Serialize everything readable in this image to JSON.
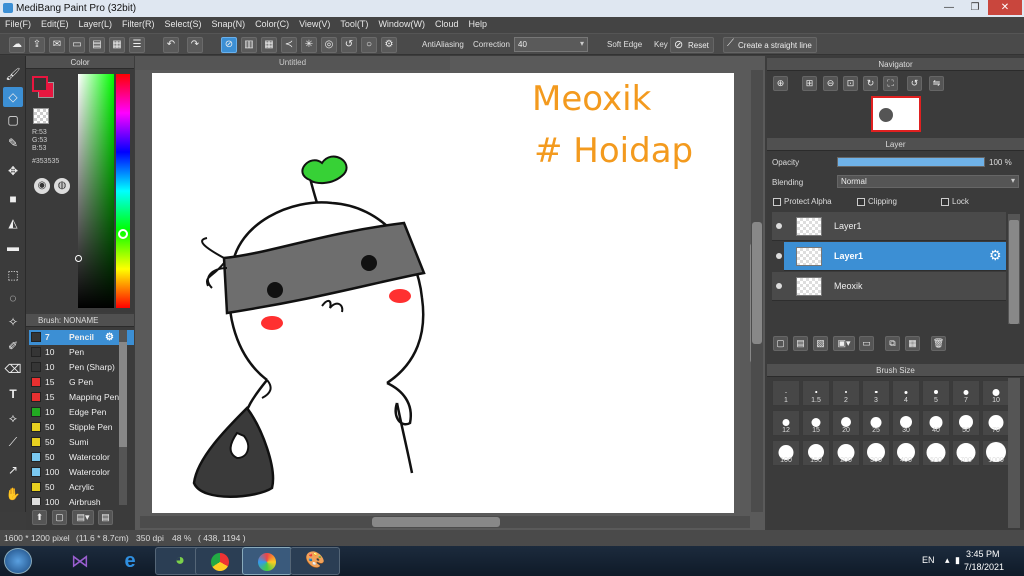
{
  "window": {
    "title": "MediBang Paint Pro (32bit)",
    "minimize": "—",
    "restore": "❐",
    "close": "✕"
  },
  "menu": [
    "File(F)",
    "Edit(E)",
    "Layer(L)",
    "Filter(R)",
    "Select(S)",
    "Snap(N)",
    "Color(C)",
    "View(V)",
    "Tool(T)",
    "Window(W)",
    "Cloud",
    "Help"
  ],
  "toolbar": {
    "antialiasing_label": "AntiAliasing",
    "correction_label": "Correction",
    "correction_value": "40",
    "soft_edge_label": "Soft Edge",
    "key_label": "Key",
    "reset_label": "Reset",
    "straight_line_label": "Create a straight line"
  },
  "color_panel": {
    "title": "Color",
    "r": "R:53",
    "g": "G:53",
    "b": "B:53",
    "hex": "#353535",
    "fg_color": "#353535",
    "bg_color": "#e8163f"
  },
  "brush_panel": {
    "title": "Brush: NONAME",
    "items": [
      {
        "size": "7",
        "name": "Pencil",
        "color": "#353535",
        "selected": true
      },
      {
        "size": "10",
        "name": "Pen",
        "color": "#353535"
      },
      {
        "size": "10",
        "name": "Pen (Sharp)",
        "color": "#353535"
      },
      {
        "size": "15",
        "name": "G Pen",
        "color": "#e83030"
      },
      {
        "size": "15",
        "name": "Mapping Pen",
        "color": "#e83030"
      },
      {
        "size": "10",
        "name": "Edge Pen",
        "color": "#22aa22"
      },
      {
        "size": "50",
        "name": "Stipple Pen",
        "color": "#e8d020"
      },
      {
        "size": "50",
        "name": "Sumi",
        "color": "#e8d020"
      },
      {
        "size": "50",
        "name": "Watercolor",
        "color": "#7ac8f0"
      },
      {
        "size": "100",
        "name": "Watercolor",
        "color": "#7ac8f0"
      },
      {
        "size": "50",
        "name": "Acrylic",
        "color": "#e8d020"
      },
      {
        "size": "100",
        "name": "Airbrush",
        "color": "#dddddd"
      }
    ]
  },
  "canvas": {
    "tab_title": "Untitled",
    "text1": "Meoxik",
    "text2": "# Hoidap",
    "text_color": "#f39a1e"
  },
  "navigator": {
    "title": "Navigator"
  },
  "layer_panel": {
    "title": "Layer",
    "opacity_label": "Opacity",
    "opacity_value": "100 %",
    "opacity_fraction": 1.0,
    "blending_label": "Blending",
    "blending_value": "Normal",
    "protect_alpha": "Protect Alpha",
    "clipping": "Clipping",
    "lock": "Lock",
    "layers": [
      {
        "name": "Layer1",
        "selected": false
      },
      {
        "name": "Layer1",
        "selected": true
      },
      {
        "name": "Meoxik",
        "selected": false
      }
    ]
  },
  "brush_size": {
    "title": "Brush Size",
    "sizes": [
      "1",
      "1.5",
      "2",
      "3",
      "4",
      "5",
      "7",
      "10",
      "12",
      "15",
      "20",
      "25",
      "30",
      "40",
      "50",
      "70",
      "100",
      "150",
      "200",
      "300",
      "400",
      "500",
      "700",
      "1000"
    ]
  },
  "status": {
    "pixel": "1600 * 1200 pixel",
    "cm": "(11.6 * 8.7cm)",
    "dpi": "350 dpi",
    "zoom": "48 %",
    "coords": "( 438, 1194 )"
  },
  "taskbar": {
    "lang": "EN",
    "time": "3:45 PM",
    "date": "7/18/2021"
  }
}
